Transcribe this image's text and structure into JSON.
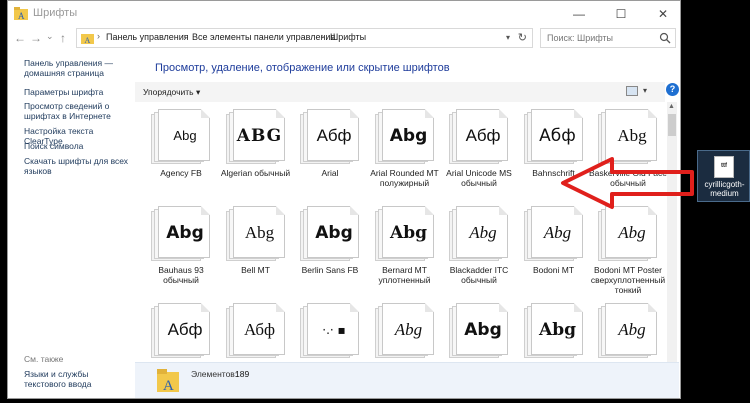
{
  "window": {
    "title": "Шрифты",
    "controls": {
      "minimize": "—",
      "maximize": "☐",
      "close": "✕"
    }
  },
  "nav": {
    "back": "←",
    "forward": "→",
    "recent": "⌄",
    "up": "↑",
    "breadcrumbs": [
      "Панель управления",
      "Все элементы панели управления",
      "Шрифты"
    ],
    "separator": "›",
    "search_placeholder": "Поиск: Шрифты"
  },
  "sidebar": {
    "items": [
      "Панель управления — домашняя страница",
      "Параметры шрифта",
      "Просмотр сведений о шрифтах в Интернете",
      "Настройка текста ClearType",
      "Поиск символа",
      "Скачать шрифты для всех языков"
    ],
    "see_also_title": "См. также",
    "see_also_items": [
      "Языки и службы текстового ввода"
    ]
  },
  "main": {
    "heading": "Просмотр, удаление, отображение или скрытие шрифтов",
    "organize_label": "Упорядочить",
    "help": "?"
  },
  "fonts": [
    {
      "sample": "Abg",
      "label": "Agency FB"
    },
    {
      "sample": "ABG",
      "label": "Algerian обычный"
    },
    {
      "sample": "Абф",
      "label": "Arial"
    },
    {
      "sample": "Abg",
      "label": "Arial Rounded MT полужирный"
    },
    {
      "sample": "Абф",
      "label": "Arial Unicode MS обычный"
    },
    {
      "sample": "Абф",
      "label": "Bahnschrift"
    },
    {
      "sample": "Abg",
      "label": "Baskerville Old Face обычный"
    },
    {
      "sample": "Abg",
      "label": "Bauhaus 93 обычный"
    },
    {
      "sample": "Abg",
      "label": "Bell MT"
    },
    {
      "sample": "Abg",
      "label": "Berlin Sans FB"
    },
    {
      "sample": "Abg",
      "label": "Bernard MT уплотненный"
    },
    {
      "sample": "Abg",
      "label": "Blackadder ITC обычный"
    },
    {
      "sample": "Abg",
      "label": "Bodoni MT"
    },
    {
      "sample": "Abg",
      "label": "Bodoni MT Poster сверхуплотненный тонкий"
    },
    {
      "sample": "Абф",
      "label": ""
    },
    {
      "sample": "Абф",
      "label": ""
    },
    {
      "sample": "·.· ▪",
      "label": ""
    },
    {
      "sample": "Abg",
      "label": ""
    },
    {
      "sample": "Abg",
      "label": ""
    },
    {
      "sample": "Abg",
      "label": ""
    },
    {
      "sample": "Abg",
      "label": ""
    }
  ],
  "details": {
    "label": "Элементов:",
    "count": "189"
  },
  "desktop_file": {
    "icon_text": "ttf",
    "name": "cyrillicgoth-medium"
  },
  "colors": {
    "arrow": "#e0201c",
    "link": "#1e395b",
    "heading": "#1e3c9b"
  }
}
